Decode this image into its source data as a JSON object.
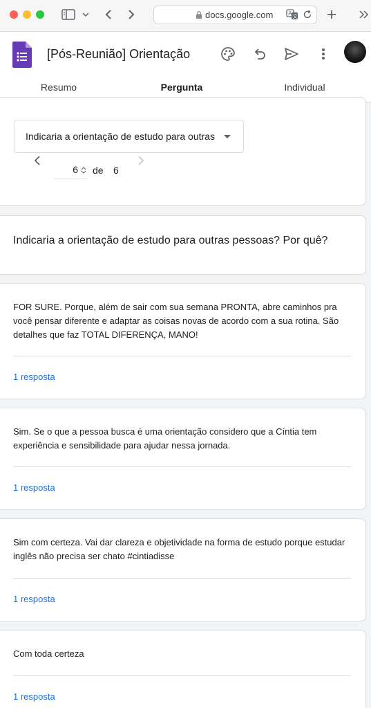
{
  "browser": {
    "url": "docs.google.com"
  },
  "header": {
    "title": "[Pós-Reunião] Orientação",
    "tabs": [
      {
        "label": "Resumo"
      },
      {
        "label": "Pergunta"
      },
      {
        "label": "Individual"
      }
    ],
    "active_tab": "Pergunta"
  },
  "question_nav": {
    "selected_question": "Indicaria a orientação de estudo para outras",
    "current": "6",
    "of_label": "de",
    "total": "6"
  },
  "question": {
    "title": "Indicaria a orientação de estudo para outras pessoas? Por quê?"
  },
  "answers": [
    {
      "text": "FOR SURE. Porque, além de sair com sua semana PRONTA, abre caminhos pra você pensar diferente e adaptar as coisas novas de acordo com a sua rotina. São detalhes que faz TOTAL DIFERENÇA, MANO!",
      "count": "1 resposta"
    },
    {
      "text": "Sim. Se o que a pessoa busca é uma orientação considero que a Cíntia tem experiência e sensibilidade para ajudar nessa jornada.",
      "count": "1 resposta"
    },
    {
      "text": "Sim com certeza. Vai dar clareza e objetividade na forma de estudo porque estudar inglês não precisa ser chato #cintiadisse",
      "count": "1 resposta"
    },
    {
      "text": "Com toda certeza",
      "count": "1 resposta"
    }
  ],
  "colors": {
    "accent": "#1a73e8",
    "forms_purple": "#673ab7"
  }
}
